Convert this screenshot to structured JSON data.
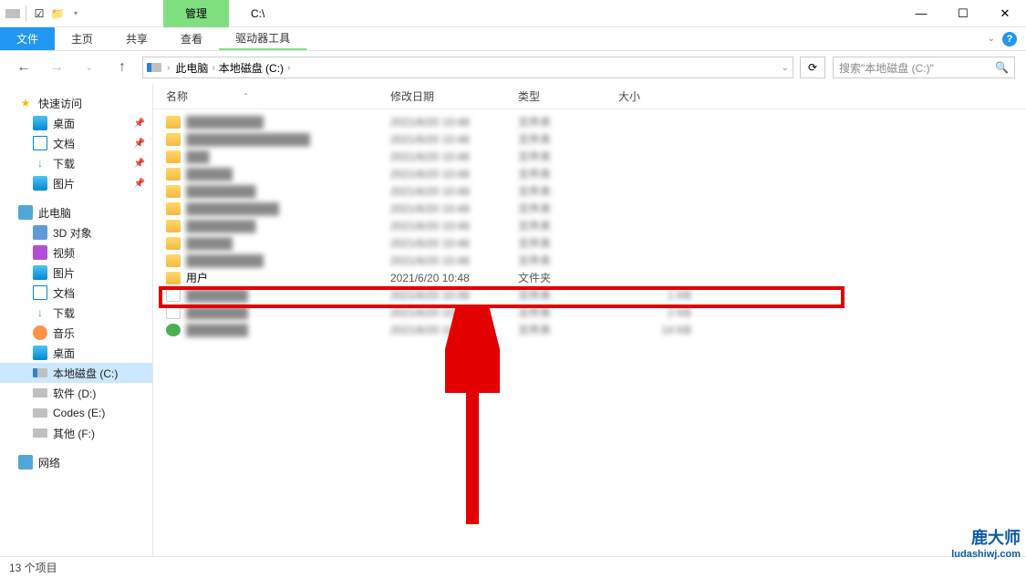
{
  "titlebar": {
    "manage_tab": "管理",
    "path_title": "C:\\"
  },
  "ribbon": {
    "file": "文件",
    "home": "主页",
    "share": "共享",
    "view": "查看",
    "drive_tools": "驱动器工具"
  },
  "breadcrumb": {
    "pc": "此电脑",
    "drive": "本地磁盘 (C:)"
  },
  "search": {
    "placeholder": "搜索\"本地磁盘 (C:)\""
  },
  "columns": {
    "name": "名称",
    "date": "修改日期",
    "type": "类型",
    "size": "大小"
  },
  "sidebar": {
    "quick": "快速访问",
    "desktop": "桌面",
    "documents": "文档",
    "downloads": "下载",
    "pictures": "图片",
    "thispc": "此电脑",
    "objects3d": "3D 对象",
    "videos": "视频",
    "pictures2": "图片",
    "documents2": "文档",
    "downloads2": "下载",
    "music": "音乐",
    "desktop2": "桌面",
    "drivec": "本地磁盘 (C:)",
    "drived": "软件 (D:)",
    "drivee": "Codes (E:)",
    "drivef": "其他 (F:)",
    "network": "网络"
  },
  "rows": {
    "highlighted": {
      "name": "用户",
      "date": "2021/6/20 10:48",
      "type": "文件夹",
      "size": ""
    },
    "blur_date_sample": "2021/6/20 10:48",
    "blur_type_sample": "文件夹"
  },
  "status": {
    "item_count": "13 个项目"
  },
  "watermark": {
    "brand": "鹿大师",
    "url": "ludashiwj.com"
  }
}
